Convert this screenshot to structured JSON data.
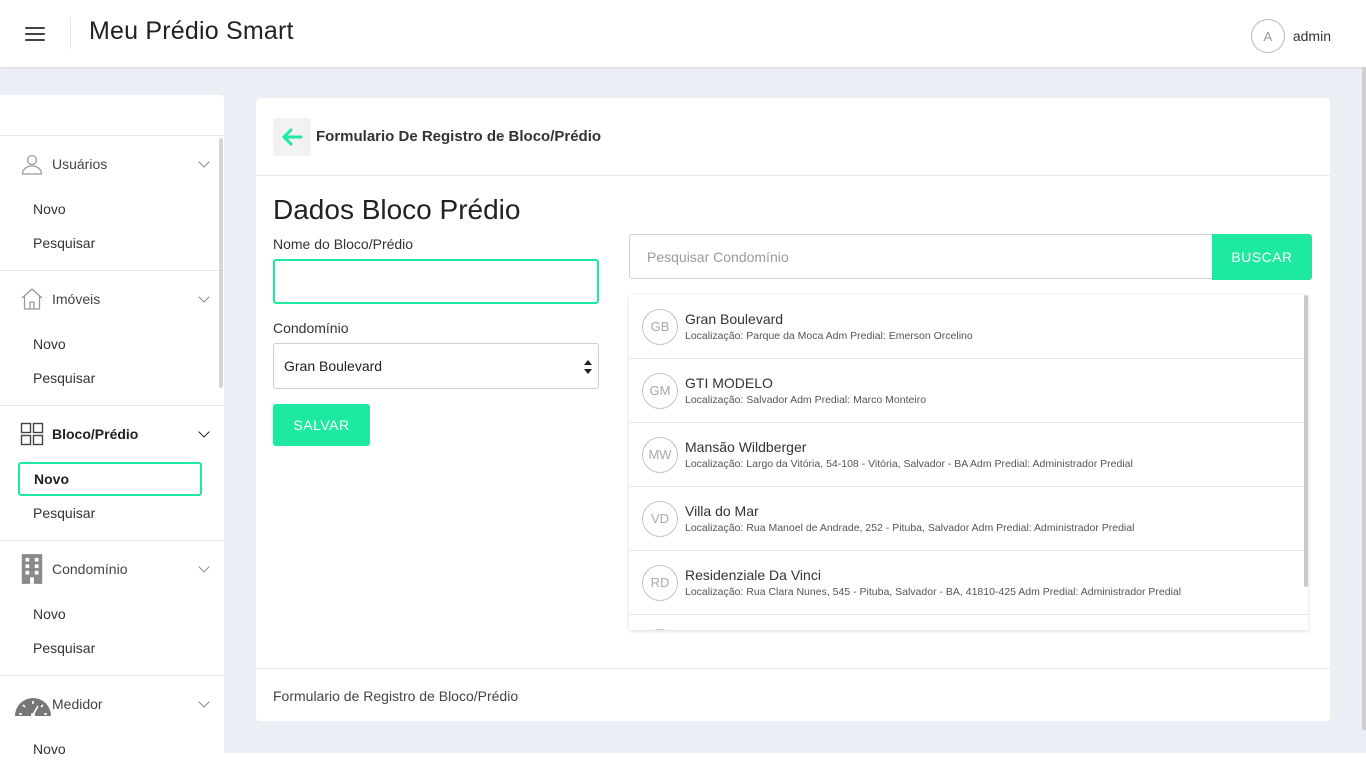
{
  "header": {
    "app_title": "Meu Prédio Smart",
    "user_initial": "A",
    "username": "admin"
  },
  "sidebar": {
    "groups": [
      {
        "label": "Usuários",
        "icon": "user-icon",
        "items": [
          "Novo",
          "Pesquisar"
        ]
      },
      {
        "label": "Imóveis",
        "icon": "house-icon",
        "items": [
          "Novo",
          "Pesquisar"
        ]
      },
      {
        "label": "Bloco/Prédio",
        "icon": "grid-icon",
        "items": [
          "Novo",
          "Pesquisar"
        ],
        "active": true,
        "selected_item": "Novo"
      },
      {
        "label": "Condomínio",
        "icon": "building-icon",
        "items": [
          "Novo",
          "Pesquisar"
        ]
      },
      {
        "label": "Medidor",
        "icon": "gauge-icon",
        "items": [
          "Novo"
        ]
      }
    ]
  },
  "card": {
    "title": "Formulario De Registro de Bloco/Prédio",
    "section_title": "Dados Bloco Prédio",
    "name_label": "Nome do Bloco/Prédio",
    "name_value": "",
    "condo_label": "Condomínio",
    "condo_selected": "Gran Boulevard",
    "save_label": "SALVAR",
    "search_placeholder": "Pesquisar Condomínio",
    "search_button": "BUSCAR",
    "footer": "Formulario de Registro de Bloco/Prédio"
  },
  "condos": [
    {
      "initials": "GB",
      "name": "Gran Boulevard",
      "location": "Localização: Parque da Moca Adm Predial: Emerson Orcelino"
    },
    {
      "initials": "GM",
      "name": "GTI MODELO",
      "location": "Localização: Salvador Adm Predial: Marco Monteiro"
    },
    {
      "initials": "MW",
      "name": "Mansão Wildberger",
      "location": "Localização: Largo da Vitória, 54-108 - Vitória, Salvador - BA Adm Predial: Administrador Predial"
    },
    {
      "initials": "VD",
      "name": "Villa do Mar",
      "location": "Localização: Rua Manoel de Andrade, 252 - Pituba, Salvador Adm Predial: Administrador Predial"
    },
    {
      "initials": "RD",
      "name": "Residenziale Da Vinci",
      "location": "Localização: Rua Clara Nunes, 545 - Pituba, Salvador - BA, 41810-425 Adm Predial: Administrador Predial"
    }
  ],
  "colors": {
    "accent": "#1de9a0",
    "background": "#eceef5"
  }
}
